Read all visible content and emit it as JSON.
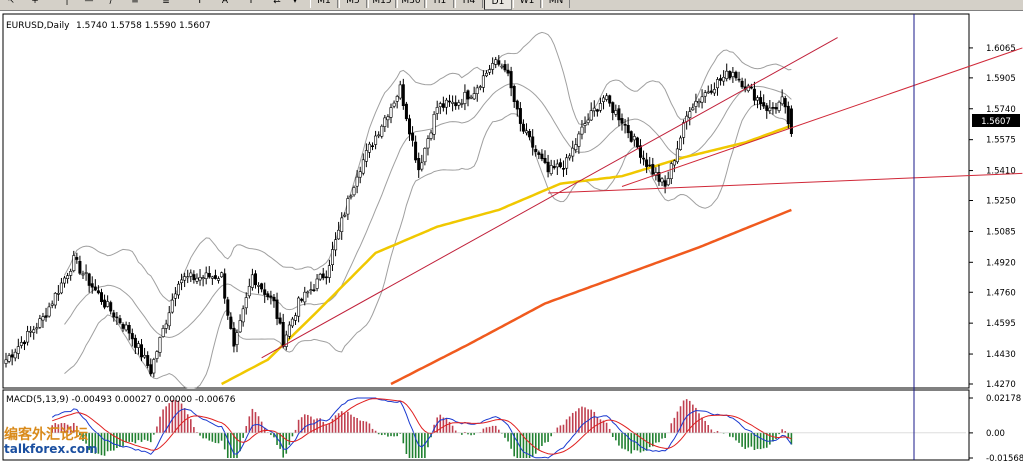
{
  "toolbar": {
    "tools": [
      "cursor-icon",
      "crosshair-icon",
      "vertical-line-icon",
      "horizontal-line-icon",
      "trendline-icon",
      "channel-icon",
      "fibonacci-icon",
      "text-icon",
      "label-icon",
      "arrow-icon"
    ],
    "text_tool": "A",
    "timeframes": [
      "M1",
      "M5",
      "M15",
      "M30",
      "H1",
      "H4",
      "D1",
      "W1",
      "MN"
    ],
    "active_timeframe": "D1"
  },
  "chart_data": [
    {
      "type": "candlestick",
      "title": "EURUSD,Daily",
      "ohlc_text": "1.5740 1.5758 1.5590 1.5607",
      "last_price": "1.5607",
      "ylim": [
        1.427,
        1.615
      ],
      "y_ticks": [
        "1.6065",
        "1.5905",
        "1.5740",
        "1.5575",
        "1.5410",
        "1.5250",
        "1.5085",
        "1.4920",
        "1.4760",
        "1.4595",
        "1.4430",
        "1.4270"
      ],
      "anchors": [
        [
          0,
          1.44
        ],
        [
          12,
          1.462
        ],
        [
          22,
          1.493
        ],
        [
          32,
          1.47
        ],
        [
          40,
          1.455
        ],
        [
          47,
          1.434
        ],
        [
          56,
          1.483
        ],
        [
          70,
          1.485
        ],
        [
          74,
          1.445
        ],
        [
          80,
          1.485
        ],
        [
          87,
          1.47
        ],
        [
          90,
          1.45
        ],
        [
          95,
          1.47
        ],
        [
          104,
          1.487
        ],
        [
          114,
          1.54
        ],
        [
          122,
          1.566
        ],
        [
          128,
          1.585
        ],
        [
          134,
          1.542
        ],
        [
          140,
          1.575
        ],
        [
          146,
          1.577
        ],
        [
          152,
          1.584
        ],
        [
          158,
          1.598
        ],
        [
          162,
          1.597
        ],
        [
          167,
          1.565
        ],
        [
          176,
          1.54
        ],
        [
          182,
          1.545
        ],
        [
          188,
          1.566
        ],
        [
          194,
          1.58
        ],
        [
          200,
          1.568
        ],
        [
          208,
          1.545
        ],
        [
          214,
          1.532
        ],
        [
          222,
          1.575
        ],
        [
          230,
          1.587
        ],
        [
          236,
          1.594
        ],
        [
          242,
          1.583
        ],
        [
          248,
          1.573
        ],
        [
          252,
          1.578
        ],
        [
          255,
          1.561
        ]
      ],
      "moving_averages": [
        {
          "color": "#f0c800",
          "anchors": [
            [
              70,
              1.427
            ],
            [
              85,
              1.44
            ],
            [
              100,
              1.464
            ],
            [
              120,
              1.497
            ],
            [
              140,
              1.511
            ],
            [
              160,
              1.52
            ],
            [
              180,
              1.534
            ],
            [
              200,
              1.538
            ],
            [
              220,
              1.548
            ],
            [
              240,
              1.556
            ],
            [
              255,
              1.565
            ]
          ]
        },
        {
          "color": "#f05a1e",
          "anchors": [
            [
              125,
              1.427
            ],
            [
              150,
              1.448
            ],
            [
              175,
              1.47
            ],
            [
              200,
              1.485
            ],
            [
              225,
              1.5
            ],
            [
              255,
              1.52
            ]
          ]
        }
      ],
      "bollinger_color": "#a0a0a0",
      "trendlines": [
        {
          "color": "#c0203a",
          "from": [
            83,
            1.441
          ],
          "to": [
            270,
            1.612
          ]
        },
        {
          "color": "#d02838",
          "from": [
            200,
            1.5325
          ],
          "to": [
            330,
            1.6065
          ]
        },
        {
          "color": "#d02838",
          "from": [
            176,
            1.529
          ],
          "to": [
            330,
            1.5395
          ]
        }
      ],
      "candle_up": "#ffffff",
      "candle_down": "#000000",
      "grid": false
    },
    {
      "type": "macd",
      "title": "MACD(5,13,9) -0.00493 0.00027 0.00000 -0.00676",
      "ylim": [
        -0.01568,
        0.02178
      ],
      "y_ticks": [
        "0.02178",
        "0.00",
        "-0.01568"
      ],
      "main_color": "#1a3ad0",
      "signal_color": "#e02020",
      "hist_up_color": "#c04050",
      "hist_down_color": "#208030"
    }
  ],
  "watermark": {
    "chinese": "编客外汇论坛",
    "url": "talkforex.com"
  }
}
